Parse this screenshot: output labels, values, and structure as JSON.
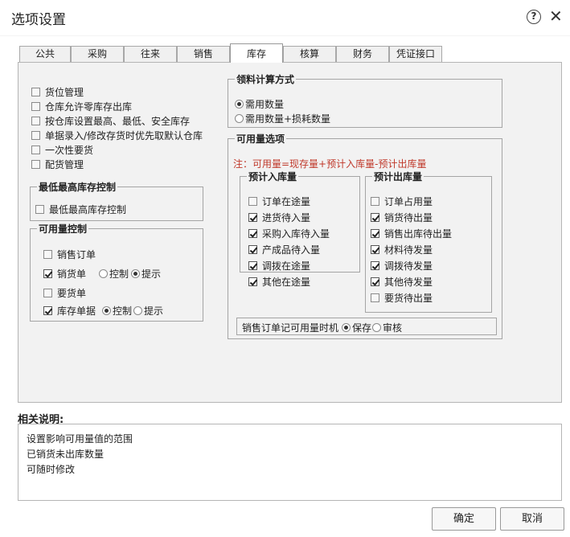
{
  "window": {
    "background_text": "",
    "title": "选项设置",
    "help_glyph": "?",
    "close_glyph": "✕"
  },
  "tabs": [
    {
      "label": "公共"
    },
    {
      "label": "采购"
    },
    {
      "label": "往来"
    },
    {
      "label": "销售"
    },
    {
      "label": "库存",
      "active": true
    },
    {
      "label": "核算"
    },
    {
      "label": "财务"
    },
    {
      "label": "凭证接口"
    }
  ],
  "left_options": [
    {
      "label": "货位管理",
      "checked": false
    },
    {
      "label": "仓库允许零库存出库",
      "checked": false
    },
    {
      "label": "按仓库设置最高、最低、安全库存",
      "checked": false
    },
    {
      "label": "单据录入/修改存货时优先取默认仓库",
      "checked": false
    },
    {
      "label": "一次性要货",
      "checked": false
    },
    {
      "label": "配货管理",
      "checked": false
    }
  ],
  "stock_limit": {
    "legend": "最低最高库存控制",
    "option": {
      "label": "最低最高库存控制",
      "checked": false
    }
  },
  "availability_control": {
    "legend": "可用量控制",
    "sales_order": {
      "label": "销售订单",
      "checked": false
    },
    "sales_bill": {
      "label": "销货单",
      "checked": true,
      "radio_control": "控制",
      "radio_prompt": "提示",
      "selected": "提示"
    },
    "request_bill": {
      "label": "要货单",
      "checked": false
    },
    "stock_bill": {
      "label": "库存单据",
      "checked": true,
      "radio_control": "控制",
      "radio_prompt": "提示",
      "selected": "控制"
    }
  },
  "material_calc": {
    "legend": "领料计算方式",
    "opt1": {
      "label": "需用数量",
      "selected": true
    },
    "opt2": {
      "label": "需用数量+损耗数量",
      "selected": false
    }
  },
  "available_options": {
    "legend": "可用量选项",
    "note": "注：可用量=现存量+预计入库量-预计出库量",
    "incoming": {
      "legend": "预计入库量",
      "items": [
        {
          "label": "订单在途量",
          "checked": false
        },
        {
          "label": "进货待入量",
          "checked": true
        },
        {
          "label": "采购入库待入量",
          "checked": true
        },
        {
          "label": "产成品待入量",
          "checked": true
        },
        {
          "label": "调拨在途量",
          "checked": true
        },
        {
          "label": "其他在途量",
          "checked": true
        }
      ]
    },
    "outgoing": {
      "legend": "预计出库量",
      "items": [
        {
          "label": "订单占用量",
          "checked": false
        },
        {
          "label": "销货待出量",
          "checked": true
        },
        {
          "label": "销售出库待出量",
          "checked": true
        },
        {
          "label": "材料待发量",
          "checked": true
        },
        {
          "label": "调拨待发量",
          "checked": true
        },
        {
          "label": "其他待发量",
          "checked": true
        },
        {
          "label": "要货待出量",
          "checked": false
        }
      ]
    },
    "timing": {
      "label": "销售订单记可用量时机",
      "opt_save": "保存",
      "opt_review": "审核",
      "selected": "保存"
    }
  },
  "description": {
    "label": "相关说明:",
    "lines": [
      "设置影响可用量值的范围",
      "已销货未出库数量",
      "可随时修改"
    ]
  },
  "buttons": {
    "ok": "确定",
    "cancel": "取消"
  }
}
